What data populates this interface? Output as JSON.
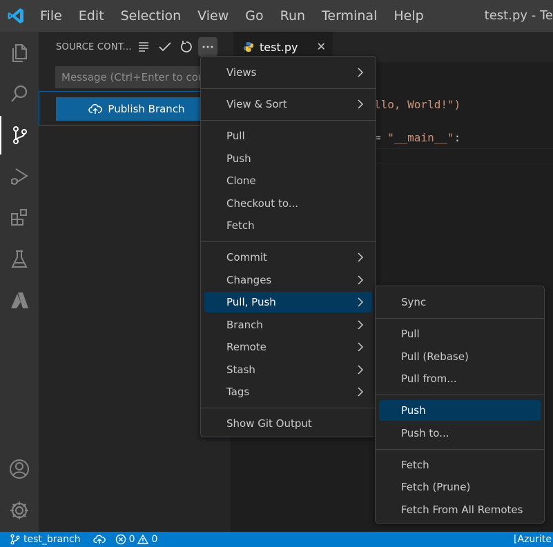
{
  "menubar": {
    "items": [
      "File",
      "Edit",
      "Selection",
      "View",
      "Go",
      "Run",
      "Terminal",
      "Help"
    ],
    "window_title": "test.py - Te"
  },
  "activity_bar": {
    "icons": [
      "files-icon",
      "search-icon",
      "source-control-icon",
      "run-debug-icon",
      "extensions-icon",
      "testing-icon",
      "azure-icon",
      "account-icon",
      "settings-gear-icon"
    ]
  },
  "sidebar": {
    "title": "SOURCE CONT...",
    "message_placeholder": "Message (Ctrl+Enter to com",
    "publish_label": "Publish Branch"
  },
  "editor": {
    "tab_label": "test.py",
    "tab_close": "✕",
    "line1": "llo, World!\")",
    "line2_pre": "= ",
    "line2_str": "\"__main__\"",
    "line2_post": ":"
  },
  "main_menu": {
    "groups": [
      [
        {
          "label": "Views",
          "submenu": true
        }
      ],
      [
        {
          "label": "View & Sort",
          "submenu": true
        }
      ],
      [
        {
          "label": "Pull"
        },
        {
          "label": "Push"
        },
        {
          "label": "Clone"
        },
        {
          "label": "Checkout to..."
        },
        {
          "label": "Fetch"
        }
      ],
      [
        {
          "label": "Commit",
          "submenu": true
        },
        {
          "label": "Changes",
          "submenu": true
        },
        {
          "label": "Pull, Push",
          "submenu": true,
          "selected": true
        },
        {
          "label": "Branch",
          "submenu": true
        },
        {
          "label": "Remote",
          "submenu": true
        },
        {
          "label": "Stash",
          "submenu": true
        },
        {
          "label": "Tags",
          "submenu": true
        }
      ],
      [
        {
          "label": "Show Git Output"
        }
      ]
    ]
  },
  "sub_menu": {
    "groups": [
      [
        {
          "label": "Sync"
        }
      ],
      [
        {
          "label": "Pull"
        },
        {
          "label": "Pull (Rebase)"
        },
        {
          "label": "Pull from..."
        }
      ],
      [
        {
          "label": "Push",
          "selected": true
        },
        {
          "label": "Push to..."
        }
      ],
      [
        {
          "label": "Fetch"
        },
        {
          "label": "Fetch (Prune)"
        },
        {
          "label": "Fetch From All Remotes"
        }
      ]
    ]
  },
  "statusbar": {
    "branch": "test_branch",
    "errors": "0",
    "warnings": "0",
    "azure": "[Azurite"
  },
  "colors": {
    "accent": "#007acc",
    "selection": "#04395e",
    "button": "#0e639c"
  }
}
